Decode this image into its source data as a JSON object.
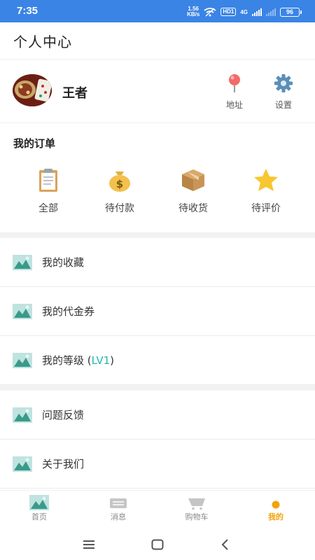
{
  "status_bar": {
    "time": "7:35",
    "net_speed_value": "1.56",
    "net_speed_unit": "KB/s",
    "hd_badge": "HD1",
    "network_type": "4G",
    "battery": "96"
  },
  "header": {
    "title": "个人中心"
  },
  "profile": {
    "username": "王者",
    "actions": [
      {
        "label": "地址",
        "icon": "location-pin-icon"
      },
      {
        "label": "设置",
        "icon": "gear-icon"
      }
    ]
  },
  "orders": {
    "title": "我的订单",
    "items": [
      {
        "label": "全部",
        "icon": "clipboard-icon"
      },
      {
        "label": "待付款",
        "icon": "money-bag-icon"
      },
      {
        "label": "待收货",
        "icon": "package-box-icon"
      },
      {
        "label": "待评价",
        "icon": "star-icon"
      }
    ]
  },
  "menu_group_1": [
    {
      "label": "我的收藏",
      "icon": "thumbnail-icon"
    },
    {
      "label": "我的代金券",
      "icon": "thumbnail-icon"
    },
    {
      "label": "我的等级 (",
      "level": "LV1",
      "suffix": ")",
      "icon": "thumbnail-icon"
    }
  ],
  "menu_group_2": [
    {
      "label": "问题反馈",
      "icon": "thumbnail-icon"
    },
    {
      "label": "关于我们",
      "icon": "thumbnail-icon"
    }
  ],
  "tabs": [
    {
      "label": "首页",
      "icon": "home-thumbnail-icon",
      "active": false
    },
    {
      "label": "消息",
      "icon": "message-icon",
      "active": false
    },
    {
      "label": "购物车",
      "icon": "cart-icon",
      "active": false
    },
    {
      "label": "我的",
      "icon": "profile-dot-icon",
      "active": true
    }
  ],
  "colors": {
    "status_bar": "#3a84e5",
    "active_tab": "#f2a20c",
    "level_accent": "#1fb7ad",
    "section_gap": "#f2f2f2"
  }
}
